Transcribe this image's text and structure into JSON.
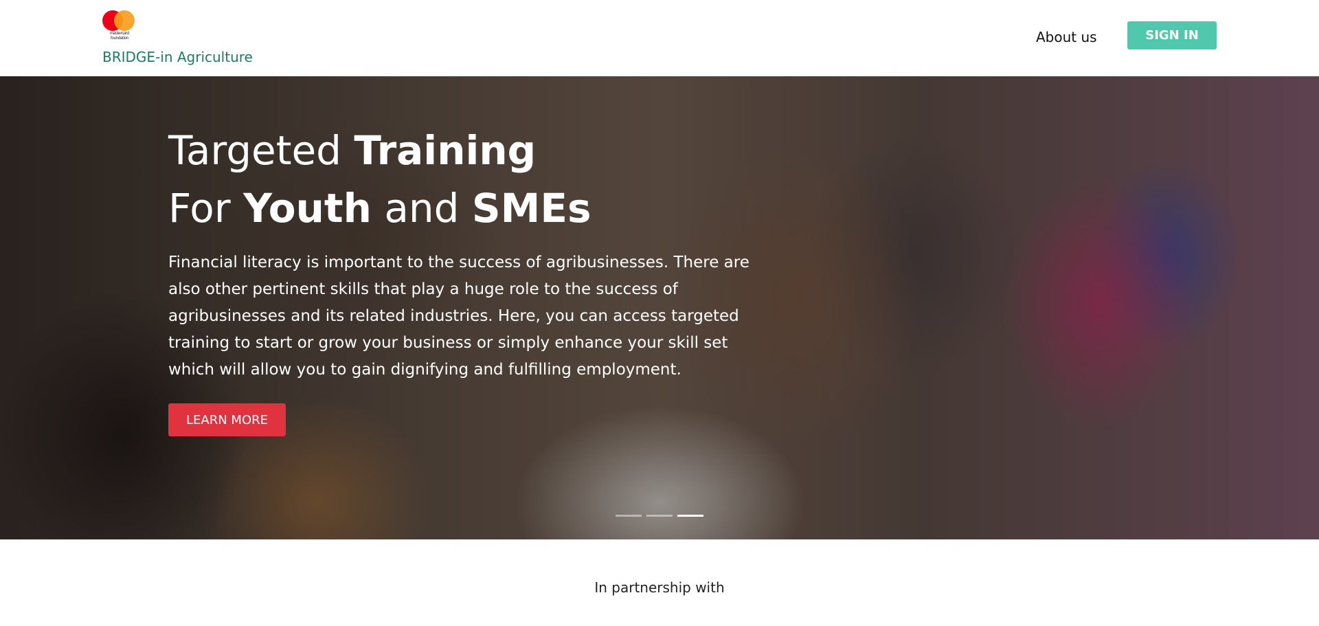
{
  "header": {
    "logo_text": "mastercard foundation",
    "brand_name": "BRIDGE-in Agriculture",
    "nav_about": "About us",
    "signin_label": "SIGN IN"
  },
  "hero": {
    "title_line1_regular": "Targeted ",
    "title_line1_bold": "Training",
    "title_line2_regular1": "For ",
    "title_line2_bold1": "Youth",
    "title_line2_regular2": " and ",
    "title_line2_bold2": "SMEs",
    "body": "Financial literacy is important to the success of agribusinesses. There are also other pertinent skills that play a huge role to the success of agribusinesses and its related industries. Here, you can access targeted training to start or grow your business or simply enhance your skill set which will allow you to gain dignifying and fulfilling employment.",
    "cta_label": "LEARN MORE",
    "slides_total": 3,
    "slide_active": 3
  },
  "partner_text": "In partnership with",
  "colors": {
    "brand_green": "#1f7a64",
    "signin_bg": "#4fc8ae",
    "cta_bg": "#e0323f",
    "mastercard_red": "#eb001b",
    "mastercard_orange": "#f79e1b"
  }
}
